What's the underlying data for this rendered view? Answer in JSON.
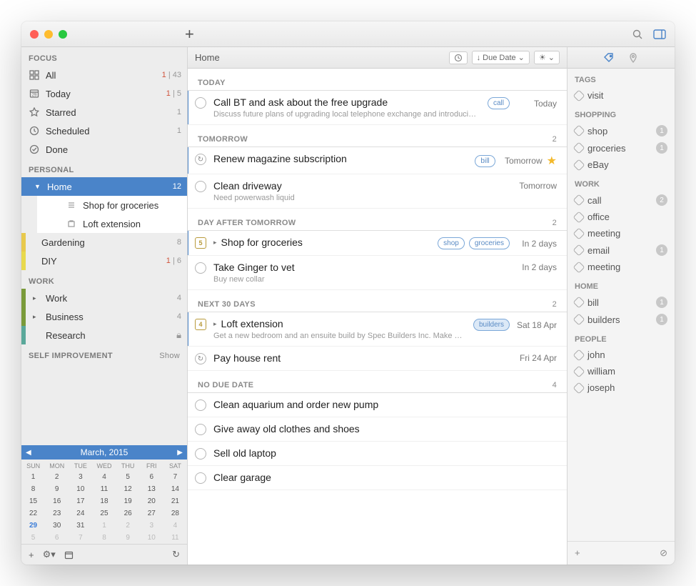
{
  "header": {
    "title": "Home",
    "sort_label": "Due Date"
  },
  "sidebar": {
    "focus_label": "FOCUS",
    "focus": [
      {
        "label": "All",
        "overdue": "1",
        "count": "43"
      },
      {
        "label": "Today",
        "overdue": "1",
        "count": "5"
      },
      {
        "label": "Starred",
        "count": "1"
      },
      {
        "label": "Scheduled",
        "count": "1"
      },
      {
        "label": "Done"
      }
    ],
    "personal_label": "PERSONAL",
    "home_label": "Home",
    "home_count": "12",
    "home_children": [
      {
        "label": "Shop for groceries"
      },
      {
        "label": "Loft extension"
      }
    ],
    "gardening_label": "Gardening",
    "gardening_count": "8",
    "diy_label": "DIY",
    "diy_overdue": "1",
    "diy_count": "6",
    "work_label": "WORK",
    "work_items": [
      {
        "label": "Work",
        "count": "4"
      },
      {
        "label": "Business",
        "count": "4"
      },
      {
        "label": "Research"
      }
    ],
    "self_label": "SELF IMPROVEMENT",
    "show": "Show"
  },
  "calendar": {
    "title": "March, 2015",
    "dow": [
      "SUN",
      "MON",
      "TUE",
      "WED",
      "THU",
      "FRI",
      "SAT"
    ],
    "weeks": [
      [
        "1",
        "2",
        "3",
        "4",
        "5",
        "6",
        "7"
      ],
      [
        "8",
        "9",
        "10",
        "11",
        "12",
        "13",
        "14"
      ],
      [
        "15",
        "16",
        "17",
        "18",
        "19",
        "20",
        "21"
      ],
      [
        "22",
        "23",
        "24",
        "25",
        "26",
        "27",
        "28"
      ],
      [
        "29",
        "30",
        "31",
        "1",
        "2",
        "3",
        "4"
      ],
      [
        "5",
        "6",
        "7",
        "8",
        "9",
        "10",
        "11"
      ]
    ],
    "today": "29"
  },
  "groups": [
    {
      "title": "TODAY",
      "count": "",
      "tasks": [
        {
          "kind": "circle",
          "title": "Call BT and ask about the free upgrade",
          "note": "Discuss future plans of upgrading local telephone exchange and introducing fibre",
          "pills": [
            "call"
          ],
          "due": "Today",
          "bar": true
        }
      ]
    },
    {
      "title": "TOMORROW",
      "count": "2",
      "tasks": [
        {
          "kind": "repeat",
          "title": "Renew magazine subscription",
          "pills": [
            "bill"
          ],
          "due": "Tomorrow",
          "star": true,
          "bar": true
        },
        {
          "kind": "circle",
          "title": "Clean driveway",
          "note": "Need powerwash liquid",
          "due": "Tomorrow"
        }
      ]
    },
    {
      "title": "DAY AFTER TOMORROW",
      "count": "2",
      "tasks": [
        {
          "kind": "date",
          "date": "5",
          "exp": true,
          "title": "Shop for groceries",
          "pills": [
            "shop",
            "groceries"
          ],
          "due": "In 2 days",
          "bar": true
        },
        {
          "kind": "circle",
          "title": "Take Ginger to vet",
          "note": "Buy new collar",
          "due": "In 2 days"
        }
      ]
    },
    {
      "title": "NEXT 30 DAYS",
      "count": "2",
      "tasks": [
        {
          "kind": "date",
          "date": "4",
          "exp": true,
          "title": "Loft extension",
          "note": "Get a new bedroom and an ensuite build by Spec Builders Inc. Make sure contract covers roof",
          "pills": [
            "builders"
          ],
          "pill_solid": true,
          "due": "Sat 18 Apr",
          "bar": true
        },
        {
          "kind": "repeat",
          "title": "Pay house rent",
          "due": "Fri 24 Apr"
        }
      ]
    },
    {
      "title": "NO DUE DATE",
      "count": "4",
      "tasks": [
        {
          "kind": "circle",
          "title": "Clean aquarium and order new pump"
        },
        {
          "kind": "circle",
          "title": "Give away old clothes and shoes"
        },
        {
          "kind": "circle",
          "title": "Sell old laptop"
        },
        {
          "kind": "circle",
          "title": "Clear garage"
        }
      ]
    }
  ],
  "tags": {
    "header": "TAGS",
    "groups": [
      {
        "title": "TAGS",
        "items": [
          {
            "label": "visit"
          }
        ]
      },
      {
        "title": "SHOPPING",
        "items": [
          {
            "label": "shop",
            "badge": "1"
          },
          {
            "label": "groceries",
            "badge": "1"
          },
          {
            "label": "eBay"
          }
        ]
      },
      {
        "title": "WORK",
        "items": [
          {
            "label": "call",
            "badge": "2"
          },
          {
            "label": "office"
          },
          {
            "label": "meeting"
          },
          {
            "label": "email",
            "badge": "1"
          },
          {
            "label": "meeting"
          }
        ]
      },
      {
        "title": "HOME",
        "items": [
          {
            "label": "bill",
            "badge": "1"
          },
          {
            "label": "builders",
            "badge": "1"
          }
        ]
      },
      {
        "title": "PEOPLE",
        "items": [
          {
            "label": "john"
          },
          {
            "label": "william"
          },
          {
            "label": "joseph"
          }
        ]
      }
    ]
  }
}
